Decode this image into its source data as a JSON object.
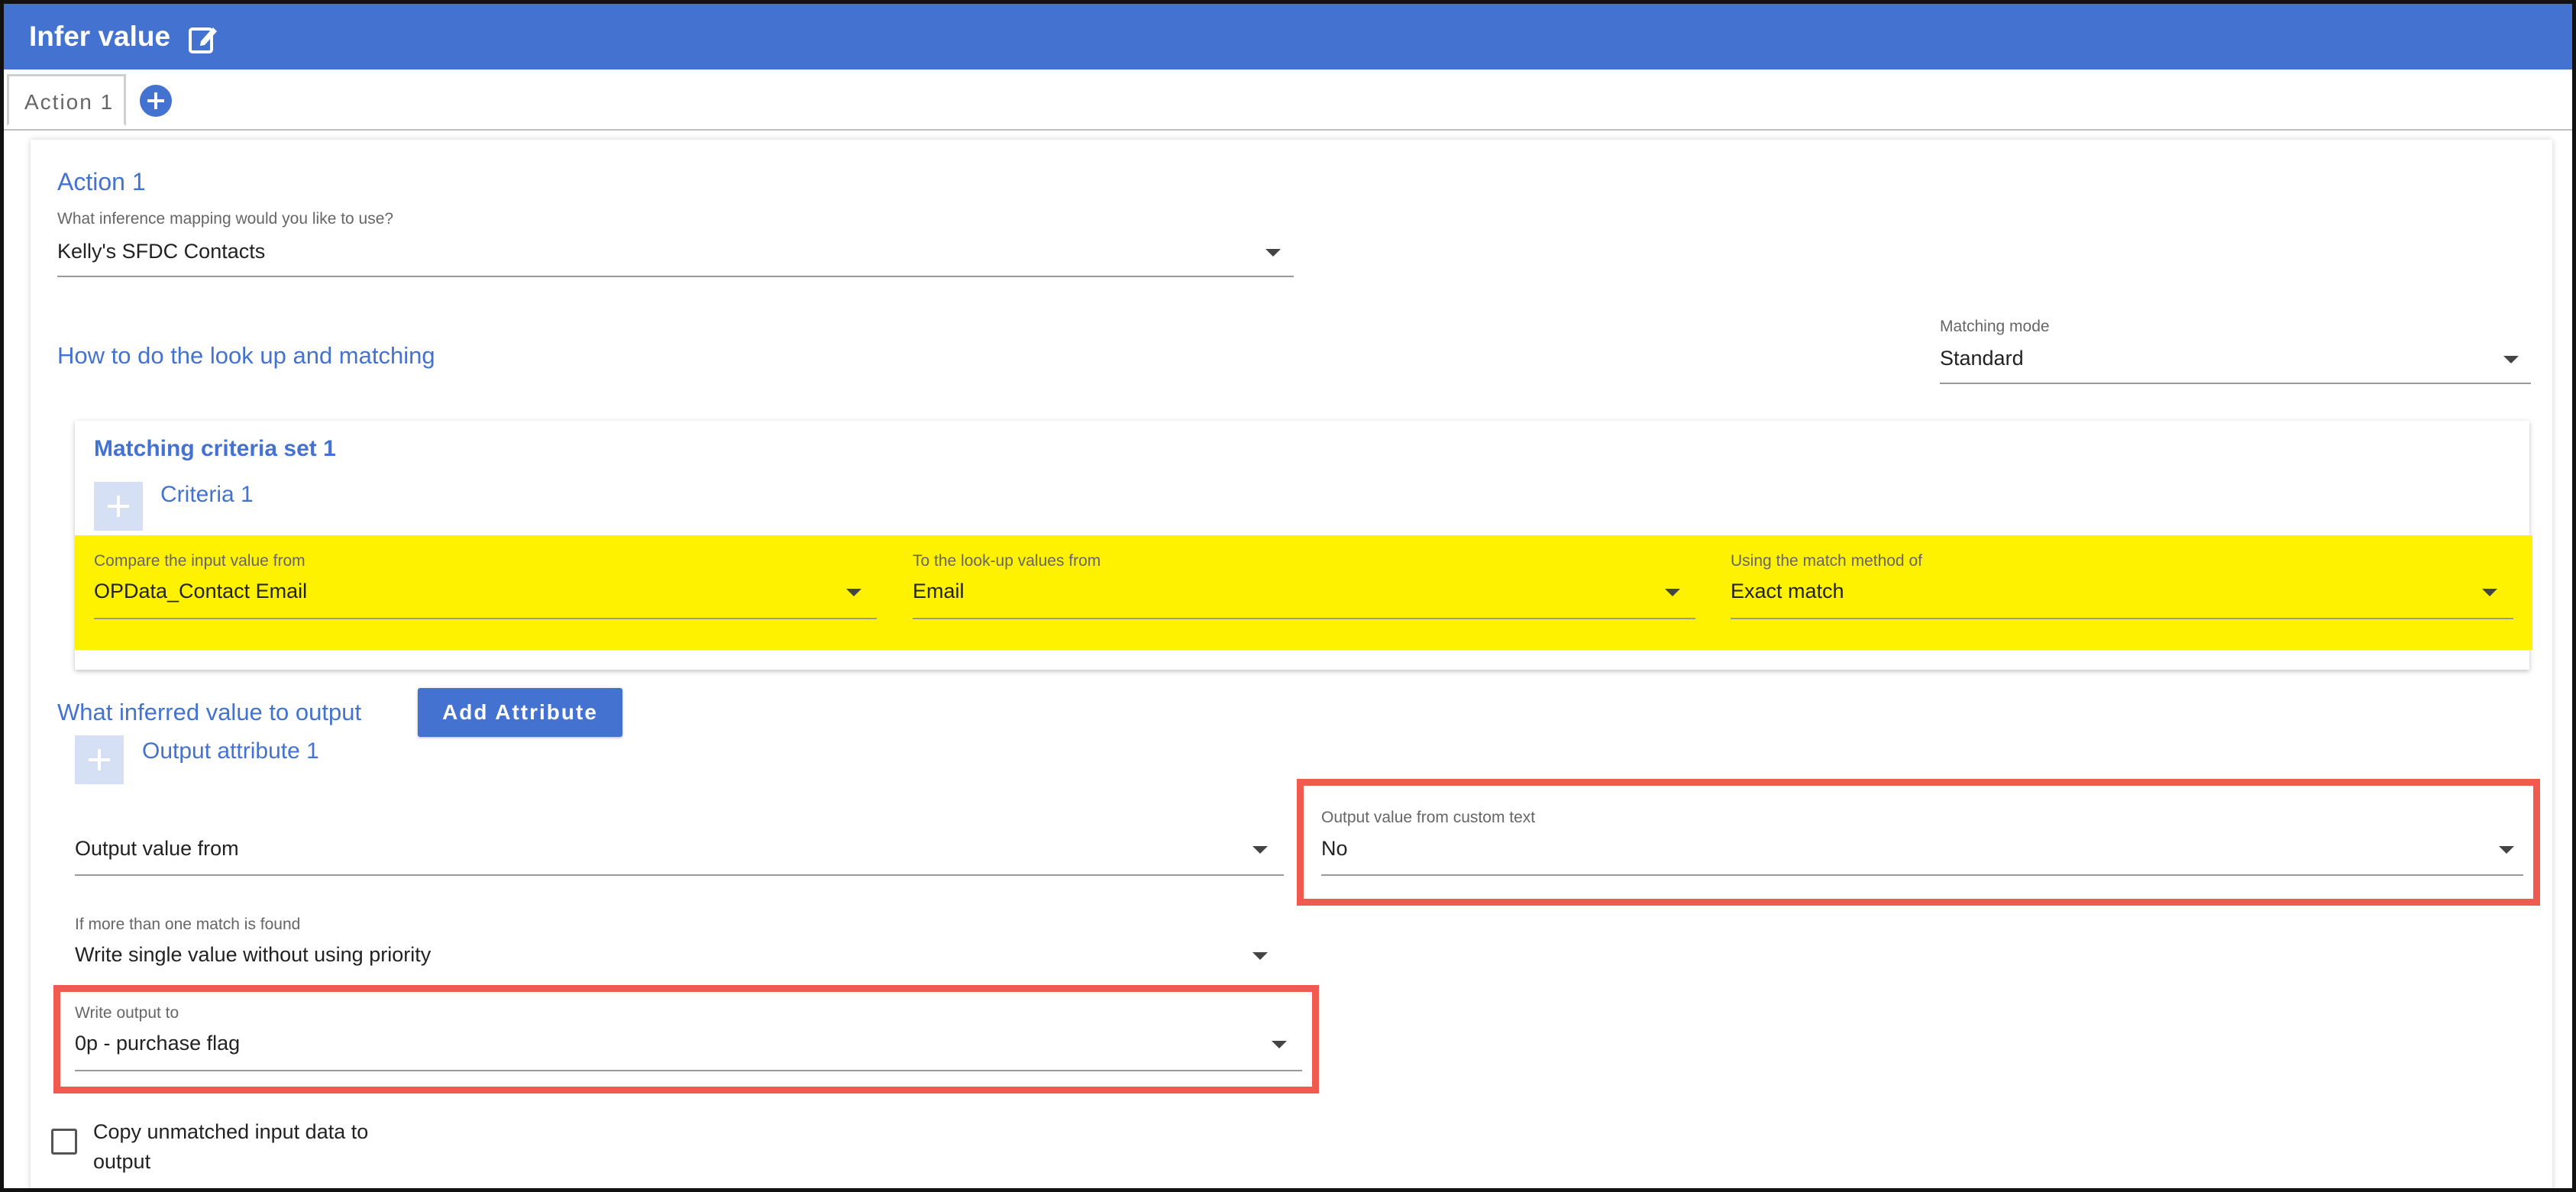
{
  "header": {
    "title": "Infer value",
    "edit_icon": "edit-icon"
  },
  "tabs": {
    "items": [
      {
        "label": "Action 1"
      }
    ],
    "add_icon": "plus-circle-icon"
  },
  "action": {
    "title": "Action 1",
    "mapping": {
      "label": "What inference mapping would you like to use?",
      "value": "Kelly's SFDC Contacts"
    },
    "lookup_heading": "How to do the look up and matching",
    "matching_mode": {
      "label": "Matching mode",
      "value": "Standard"
    },
    "criteria_set": {
      "title": "Matching criteria set 1",
      "criteria_label": "Criteria 1",
      "compare_from": {
        "label": "Compare the input value from",
        "value": "OPData_Contact Email"
      },
      "lookup_from": {
        "label": "To the look-up values from",
        "value": "Email"
      },
      "match_method": {
        "label": "Using the match method of",
        "value": "Exact match"
      }
    },
    "output_heading": "What inferred value to output",
    "add_attribute_label": "Add Attribute",
    "output_attribute_label": "Output attribute 1",
    "output_value_from": {
      "label": "",
      "value": "Output value from"
    },
    "custom_text": {
      "label": "Output value from custom text",
      "value": "No"
    },
    "multi_match": {
      "label": "If more than one match is found",
      "value": "Write single value without using priority"
    },
    "write_output": {
      "label": "Write output to",
      "value": "0p - purchase flag"
    },
    "copy_unmatched": {
      "label": "Copy unmatched input data to output",
      "checked": false
    }
  },
  "colors": {
    "accent": "#4472d0",
    "highlight": "#fff200",
    "annotation": "#f15b4f"
  }
}
